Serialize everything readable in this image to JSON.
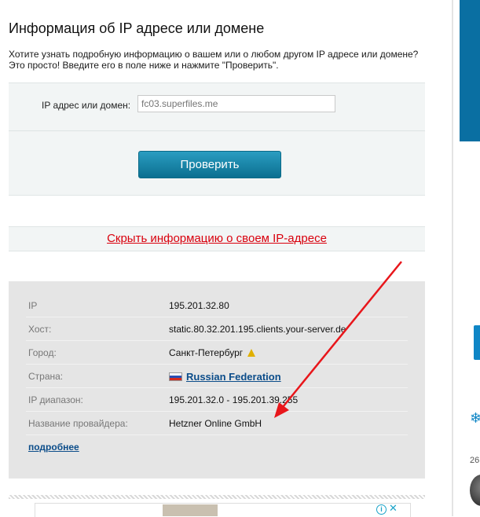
{
  "page": {
    "title": "Информация об IP адресе или домене",
    "intro_line1": "Хотите узнать подробную информацию о вашем или о любом другом IP адресе или домене?",
    "intro_line2": "Это просто! Введите его в поле ниже и нажмите \"Проверить\"."
  },
  "form": {
    "label": "IP адрес или домен:",
    "input_value": "",
    "input_placeholder": "fc03.superfiles.me",
    "submit_label": "Проверить"
  },
  "hide_link": "Скрыть информацию о своем IP-адресе",
  "info": {
    "rows": [
      {
        "label": "IP",
        "value": "195.201.32.80"
      },
      {
        "label": "Хост:",
        "value": "static.80.32.201.195.clients.your-server.de"
      },
      {
        "label": "Город:",
        "value": "Санкт-Петербург"
      },
      {
        "label": "Страна:",
        "value": "Russian Federation"
      },
      {
        "label": "IP диапазон:",
        "value": "195.201.32.0 - 195.201.39.255"
      },
      {
        "label": "Название провайдера:",
        "value": "Hetzner Online GmbH"
      }
    ],
    "more_link": "подробнее"
  },
  "sidebar": {
    "count_text": "26"
  },
  "colors": {
    "accent_button": "#0b6f90",
    "hide_link": "#d9000d",
    "link": "#0c4d8a",
    "annotation_arrow": "#e8161b"
  },
  "icons": [
    "warning-icon",
    "russia-flag-icon",
    "ad-info-icon",
    "ad-close-icon",
    "arrow-annotation"
  ]
}
